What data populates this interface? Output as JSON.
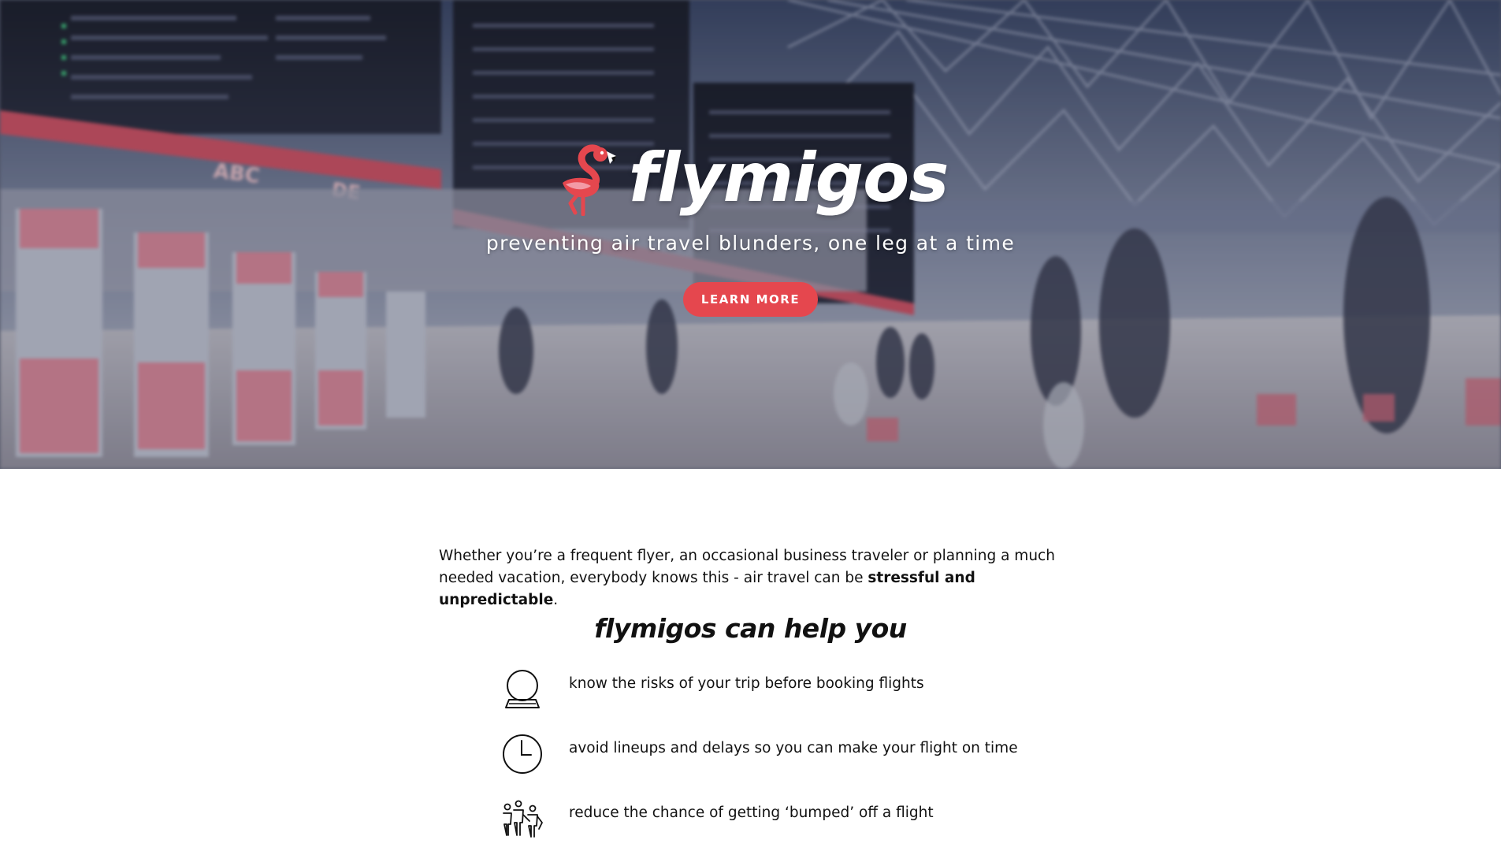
{
  "hero": {
    "brand_name": "flymigos",
    "tagline": "preventing air travel blunders, one leg at a time",
    "cta_label": "LEARN MORE",
    "background_image": "blurred airport terminal with departure boards and travelers",
    "board_text": {
      "zone_abc": "ABC",
      "zone_de": "DE"
    }
  },
  "intro": {
    "text_before": "Whether you’re a frequent flyer, an occasional business traveler or planning a much needed vacation, everybody knows this - air travel can be ",
    "emphasis": "stressful and unpredictable",
    "text_after": "."
  },
  "benefits_section": {
    "title": "flymigos can help you",
    "items": [
      {
        "icon": "crystal-ball-icon",
        "text": "know the risks of your trip before booking flights"
      },
      {
        "icon": "clock-icon",
        "text": "avoid lineups and delays so you can make your flight on time"
      },
      {
        "icon": "people-bumped-icon",
        "text": "reduce the chance of getting ‘bumped’ off a flight"
      }
    ]
  },
  "colors": {
    "accent": "#e5474e",
    "flamingo_pink": "#f07b86",
    "text": "#111111"
  }
}
